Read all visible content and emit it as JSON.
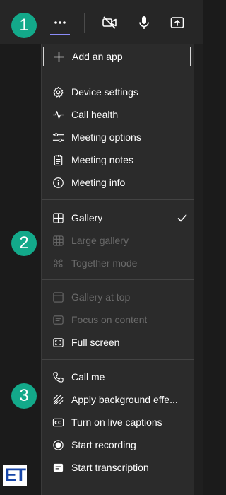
{
  "toolbar": {
    "icons": [
      "more-options-icon",
      "camera-off-icon",
      "microphone-icon",
      "share-screen-icon"
    ],
    "accent": "#8b8cf8"
  },
  "badges": [
    "1",
    "2",
    "3"
  ],
  "badge_color": "#13a98a",
  "menu": {
    "add_app": "Add an app",
    "device_settings": "Device settings",
    "call_health": "Call health",
    "meeting_options": "Meeting options",
    "meeting_notes": "Meeting notes",
    "meeting_info": "Meeting info",
    "gallery": "Gallery",
    "large_gallery": "Large gallery",
    "together_mode": "Together mode",
    "gallery_at_top": "Gallery at top",
    "focus_on_content": "Focus on content",
    "full_screen": "Full screen",
    "call_me": "Call me",
    "apply_background": "Apply background effe...",
    "live_captions": "Turn on live captions",
    "start_recording": "Start recording",
    "start_transcription": "Start transcription"
  },
  "logo_text": "ET"
}
